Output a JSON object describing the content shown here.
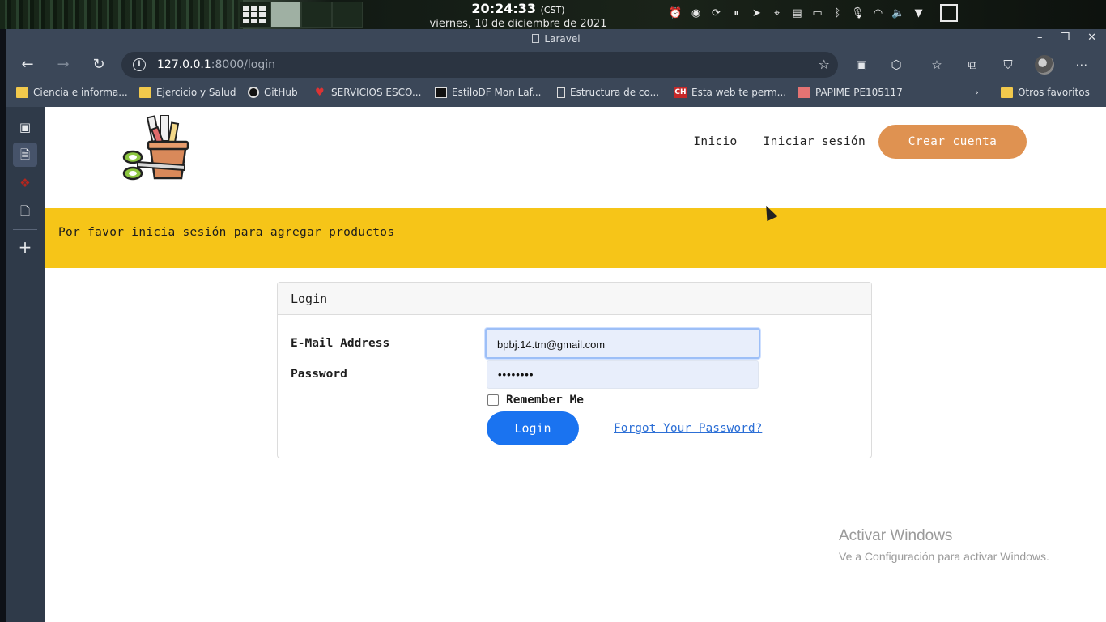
{
  "os": {
    "time": "20:24:33",
    "timezone": "(CST)",
    "date": "viernes, 10 de diciembre de 2021"
  },
  "browser": {
    "window_title": "Laravel",
    "url_host": "127.0.0.1",
    "url_rest": ":8000/login",
    "bookmarks": [
      "Ciencia e informa...",
      "Ejercicio y Salud",
      "GitHub",
      "SERVICIOS ESCO...",
      "EstiloDF Mon Laf...",
      "Estructura de co...",
      "Esta web te perm...",
      "PAPIME PE105117",
      "Otros favoritos"
    ]
  },
  "nav": {
    "home": "Inicio",
    "login": "Iniciar sesión",
    "register": "Crear cuenta"
  },
  "alert": {
    "message": "Por favor inicia sesión para agregar productos"
  },
  "login_card": {
    "header": "Login",
    "email_label": "E-Mail Address",
    "email_value": "bpbj.14.tm@gmail.com",
    "password_label": "Password",
    "password_value": "••••••••",
    "remember_label": "Remember Me",
    "submit_label": "Login",
    "forgot_label": "Forgot Your Password?"
  },
  "watermark": {
    "title": "Activar Windows",
    "subtitle": "Ve a Configuración para activar Windows."
  },
  "colors": {
    "alert_bg": "#f6c518",
    "cta_bg": "#df9251",
    "login_btn": "#1a73f0",
    "browser_chrome": "#3b4758"
  }
}
